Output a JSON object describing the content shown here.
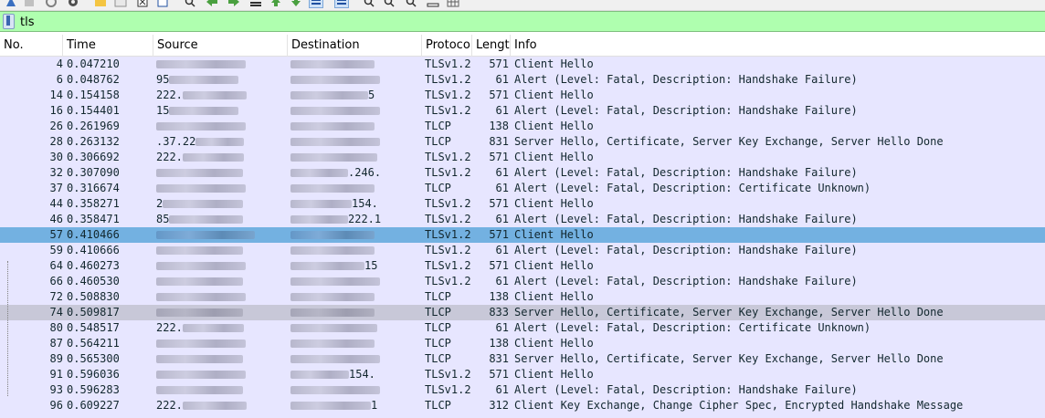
{
  "toolbar": {
    "icons": [
      "shark-fin-icon",
      "stop-icon",
      "restart-icon",
      "options-icon",
      "open-file-icon",
      "save-file-icon",
      "close-file-icon",
      "reload-icon",
      "find-icon",
      "go-back-icon",
      "go-forward-icon",
      "go-to-packet-icon",
      "first-packet-icon",
      "last-packet-icon",
      "auto-scroll-icon",
      "colorize-icon",
      "zoom-in-icon",
      "zoom-out-icon",
      "normal-size-icon",
      "resize-columns-icon",
      "table-icon"
    ]
  },
  "filter": {
    "value": "tls"
  },
  "columns": [
    "No.",
    "Time",
    "Source",
    "Destination",
    "Protoco",
    "Lengt",
    "Info"
  ],
  "packets": [
    {
      "no": "4",
      "time": "0.047210",
      "src_vis": "",
      "dst_vis": "",
      "proto": "TLSv1.2",
      "len": "571",
      "info": "Client Hello"
    },
    {
      "no": "6",
      "time": "0.048762",
      "src_vis": "95",
      "dst_vis": "",
      "proto": "TLSv1.2",
      "len": "61",
      "info": "Alert (Level: Fatal, Description: Handshake Failure)"
    },
    {
      "no": "14",
      "time": "0.154158",
      "src_vis": "222.",
      "dst_vis": "5",
      "proto": "TLSv1.2",
      "len": "571",
      "info": "Client Hello"
    },
    {
      "no": "16",
      "time": "0.154401",
      "src_vis": "15",
      "dst_vis": "",
      "proto": "TLSv1.2",
      "len": "61",
      "info": "Alert (Level: Fatal, Description: Handshake Failure)"
    },
    {
      "no": "26",
      "time": "0.261969",
      "src_vis": "",
      "dst_vis": "",
      "proto": "TLCP",
      "len": "138",
      "info": "Client Hello"
    },
    {
      "no": "28",
      "time": "0.263132",
      "src_vis": ".37.22",
      "dst_vis": "",
      "proto": "TLCP",
      "len": "831",
      "info": "Server Hello, Certificate, Server Key Exchange, Server Hello Done"
    },
    {
      "no": "30",
      "time": "0.306692",
      "src_vis": "222.",
      "dst_vis": "",
      "proto": "TLSv1.2",
      "len": "571",
      "info": "Client Hello"
    },
    {
      "no": "32",
      "time": "0.307090",
      "src_vis": "",
      "dst_vis": ".246.",
      "proto": "TLSv1.2",
      "len": "61",
      "info": "Alert (Level: Fatal, Description: Handshake Failure)"
    },
    {
      "no": "37",
      "time": "0.316674",
      "src_vis": "",
      "dst_vis": "",
      "proto": "TLCP",
      "len": "61",
      "info": "Alert (Level: Fatal, Description: Certificate Unknown)"
    },
    {
      "no": "44",
      "time": "0.358271",
      "src_vis": "2",
      "dst_vis": "154.",
      "proto": "TLSv1.2",
      "len": "571",
      "info": "Client Hello"
    },
    {
      "no": "46",
      "time": "0.358471",
      "src_vis": "85",
      "dst_vis": "222.1",
      "proto": "TLSv1.2",
      "len": "61",
      "info": "Alert (Level: Fatal, Description: Handshake Failure)"
    },
    {
      "no": "57",
      "time": "0.410466",
      "src_vis": "",
      "dst_vis": "",
      "proto": "TLSv1.2",
      "len": "571",
      "info": "Client Hello",
      "selected": true
    },
    {
      "no": "59",
      "time": "0.410666",
      "src_vis": "",
      "dst_vis": "",
      "proto": "TLSv1.2",
      "len": "61",
      "info": "Alert (Level: Fatal, Description: Handshake Failure)"
    },
    {
      "no": "64",
      "time": "0.460273",
      "src_vis": "",
      "dst_vis": "15",
      "proto": "TLSv1.2",
      "len": "571",
      "info": "Client Hello"
    },
    {
      "no": "66",
      "time": "0.460530",
      "src_vis": "",
      "dst_vis": "",
      "proto": "TLSv1.2",
      "len": "61",
      "info": "Alert (Level: Fatal, Description: Handshake Failure)"
    },
    {
      "no": "72",
      "time": "0.508830",
      "src_vis": "",
      "dst_vis": "",
      "proto": "TLCP",
      "len": "138",
      "info": "Client Hello"
    },
    {
      "no": "74",
      "time": "0.509817",
      "src_vis": "",
      "dst_vis": "",
      "proto": "TLCP",
      "len": "833",
      "info": "Server Hello, Certificate, Server Key Exchange, Server Hello Done",
      "gray": true
    },
    {
      "no": "80",
      "time": "0.548517",
      "src_vis": "222.",
      "dst_vis": "",
      "proto": "TLCP",
      "len": "61",
      "info": "Alert (Level: Fatal, Description: Certificate Unknown)"
    },
    {
      "no": "87",
      "time": "0.564211",
      "src_vis": "",
      "dst_vis": "",
      "proto": "TLCP",
      "len": "138",
      "info": "Client Hello"
    },
    {
      "no": "89",
      "time": "0.565300",
      "src_vis": "",
      "dst_vis": "",
      "proto": "TLCP",
      "len": "831",
      "info": "Server Hello, Certificate, Server Key Exchange, Server Hello Done"
    },
    {
      "no": "91",
      "time": "0.596036",
      "src_vis": "",
      "dst_vis": "154.",
      "proto": "TLSv1.2",
      "len": "571",
      "info": "Client Hello"
    },
    {
      "no": "93",
      "time": "0.596283",
      "src_vis": "",
      "dst_vis": "",
      "proto": "TLSv1.2",
      "len": "61",
      "info": "Alert (Level: Fatal, Description: Handshake Failure)"
    },
    {
      "no": "96",
      "time": "0.609227",
      "src_vis": "222.",
      "dst_vis": "1",
      "proto": "TLCP",
      "len": "312",
      "info": "Client Key Exchange, Change Cipher Spec, Encrypted Handshake Message"
    },
    {
      "no": "",
      "time": "",
      "src_vis": "",
      "dst_vis": "",
      "proto": "",
      "len": "",
      "info": ""
    }
  ]
}
